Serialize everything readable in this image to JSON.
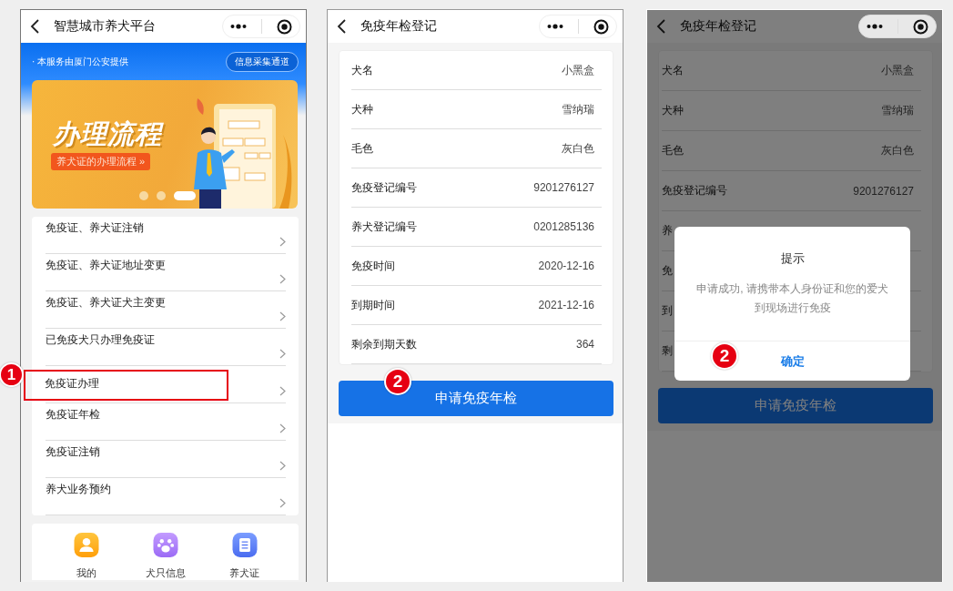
{
  "screens": [
    {
      "kind": "home",
      "nav": {
        "title": "智慧城市养犬平台"
      },
      "notice": "· 本服务由厦门公安提供",
      "notice_button": "信息采集通道",
      "banner": {
        "headline": "办理流程",
        "link": "养犬证的办理流程 »",
        "dots": [
          {
            "selected": false
          },
          {
            "selected": false
          },
          {
            "selected": true
          }
        ]
      },
      "menu": [
        {
          "label": "免疫证、养犬证注销",
          "highlighted": false
        },
        {
          "label": "免疫证、养犬证地址变更",
          "highlighted": false
        },
        {
          "label": "免疫证、养犬证犬主变更",
          "highlighted": false
        },
        {
          "label": "已免疫犬只办理免疫证",
          "highlighted": false
        },
        {
          "label": "免疫证办理",
          "highlighted": true,
          "step": "1"
        },
        {
          "label": "免疫证年检",
          "highlighted": false
        },
        {
          "label": "免疫证注销",
          "highlighted": false
        },
        {
          "label": "养犬业务预约",
          "highlighted": false
        }
      ],
      "tabs": [
        {
          "label": "我的"
        },
        {
          "label": "犬只信息"
        },
        {
          "label": "养犬证"
        }
      ]
    },
    {
      "kind": "form",
      "dimmed": false,
      "nav": {
        "title": "免疫年检登记"
      },
      "fields": [
        {
          "label": "犬名",
          "value": "小黑盒"
        },
        {
          "label": "犬种",
          "value": "雪纳瑞"
        },
        {
          "label": "毛色",
          "value": "灰白色"
        },
        {
          "label": "免疫登记编号",
          "value": "9201276127"
        },
        {
          "label": "养犬登记编号",
          "value": "0201285136"
        },
        {
          "label": "免疫时间",
          "value": "2020-12-16"
        },
        {
          "label": "到期时间",
          "value": "2021-12-16"
        },
        {
          "label": "剩余到期天数",
          "value": "364"
        }
      ],
      "button": {
        "label": "申请免疫年检",
        "step": "2"
      }
    },
    {
      "kind": "form",
      "dimmed": true,
      "nav": {
        "title": "免疫年检登记"
      },
      "fields": [
        {
          "label": "犬名",
          "value": "小黑盒"
        },
        {
          "label": "犬种",
          "value": "雪纳瑞"
        },
        {
          "label": "毛色",
          "value": "灰白色"
        },
        {
          "label": "免疫登记编号",
          "value": "9201276127"
        },
        {
          "label": "养"
        },
        {
          "label": "免"
        },
        {
          "label": "到"
        },
        {
          "label": "剩"
        }
      ],
      "button": {
        "label": "申请免疫年检"
      },
      "dialog": {
        "title": "提示",
        "message": "申请成功, 请携带本人身份证和您的爱犬到现场进行免疫",
        "confirm": "确定",
        "step": "2"
      }
    }
  ]
}
